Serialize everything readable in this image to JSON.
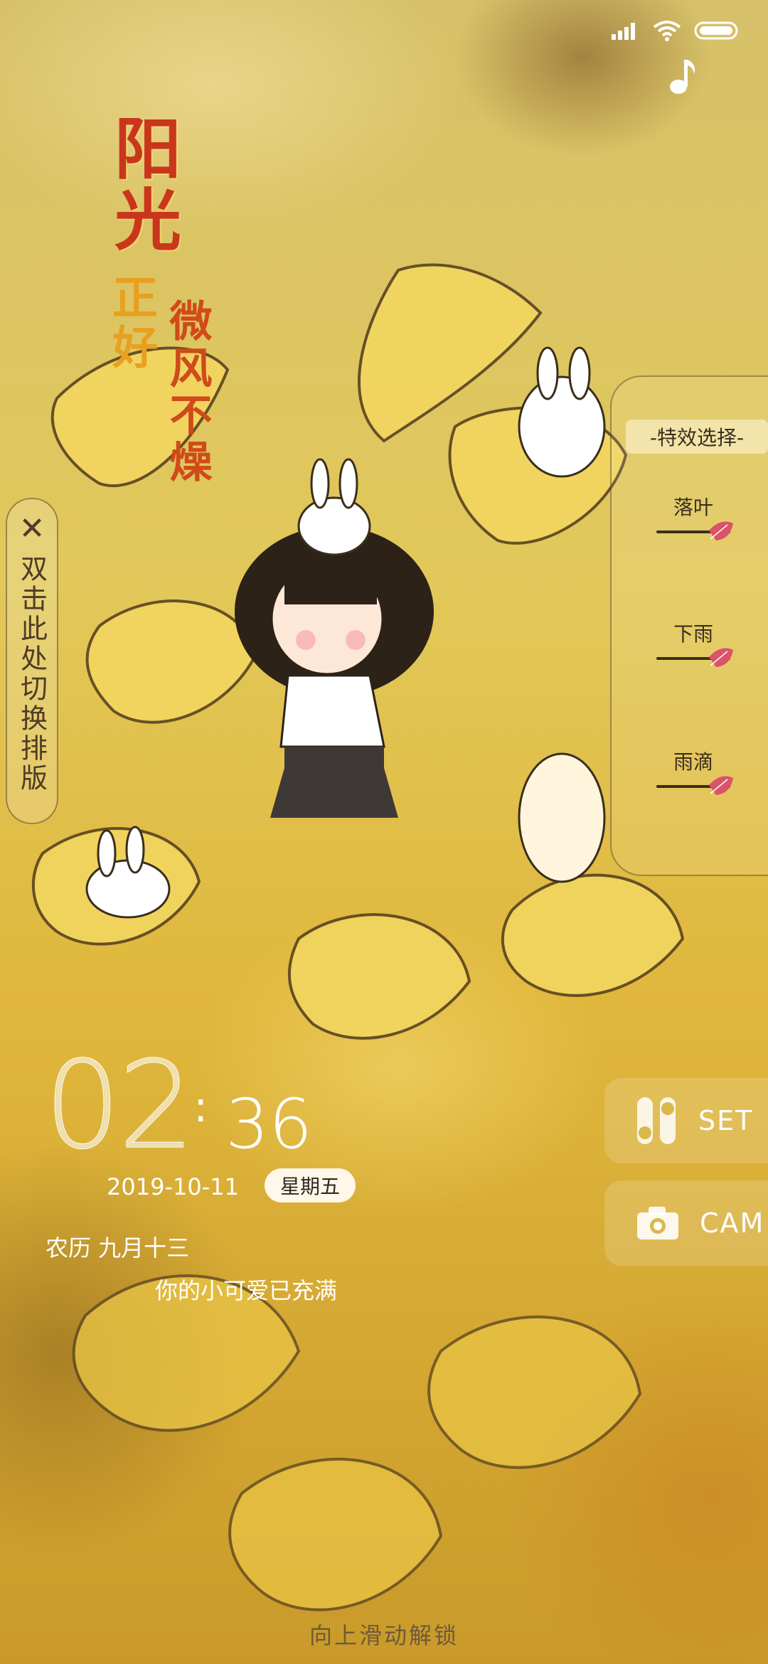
{
  "status_bar": {
    "signal_icon": "signal-bars-icon",
    "wifi_icon": "wifi-icon",
    "battery_icon": "battery-icon"
  },
  "music_icon": "music-note-icon",
  "titles": {
    "line1": "阳光",
    "line2": "正好",
    "line3": "微风不燥"
  },
  "layout_toggle": {
    "close_icon": "close-icon",
    "label": "双击此处切换排版"
  },
  "effects_panel": {
    "title": "-特效选择-",
    "items": [
      {
        "label": "落叶",
        "icon": "leaf-slider-knob-icon"
      },
      {
        "label": "下雨",
        "icon": "leaf-slider-knob-icon"
      },
      {
        "label": "雨滴",
        "icon": "leaf-slider-knob-icon"
      }
    ]
  },
  "clock": {
    "hour": "02",
    "separator": ":",
    "minute": "36"
  },
  "date": "2019-10-11",
  "weekday": "星期五",
  "lunar": "农历  九月十三",
  "charge_status": "你的小可爱已充满",
  "buttons": {
    "set_label": "SET",
    "cam_label": "CAM"
  },
  "unlock_hint": "向上滑动解锁",
  "colors": {
    "accent_red": "#c9361c",
    "accent_orange": "#e8a020",
    "leaf_pink": "#d9536a"
  }
}
